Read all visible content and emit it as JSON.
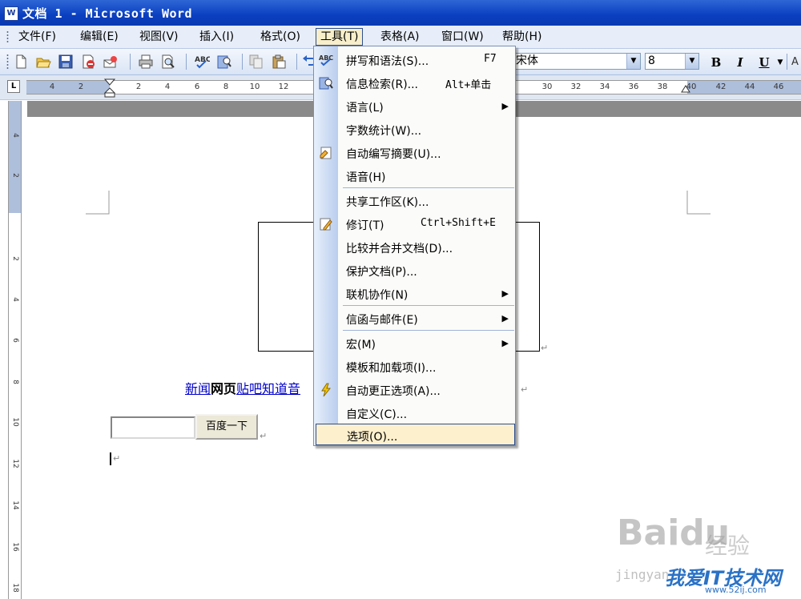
{
  "window": {
    "title": "文档 1 - Microsoft Word",
    "app_icon": "W"
  },
  "menubar": {
    "items": [
      {
        "label": "文件(F)"
      },
      {
        "label": "编辑(E)"
      },
      {
        "label": "视图(V)"
      },
      {
        "label": "插入(I)"
      },
      {
        "label": "格式(O)"
      },
      {
        "label": "工具(T)",
        "active": true
      },
      {
        "label": "表格(A)"
      },
      {
        "label": "窗口(W)"
      },
      {
        "label": "帮助(H)"
      }
    ]
  },
  "toolbar": {
    "font_name": "宋体",
    "font_size": "8",
    "bold_label": "B",
    "italic_label": "I",
    "underline_label": "U",
    "icons": [
      "new-icon",
      "open-icon",
      "save-icon",
      "permission-icon",
      "email-icon",
      "print-icon",
      "print-preview-icon",
      "spelling-icon",
      "research-icon",
      "copy-icon",
      "paste-icon",
      "undo-icon"
    ]
  },
  "ruler": {
    "tab_selector": "L",
    "numbers": [
      "4",
      "2",
      "2",
      "4",
      "6",
      "8",
      "10",
      "12",
      "30",
      "32",
      "34",
      "36",
      "38",
      "40",
      "42",
      "44",
      "46"
    ]
  },
  "vruler": {
    "numbers": [
      "4",
      "2",
      "2",
      "4",
      "6",
      "8",
      "10",
      "12",
      "14",
      "16",
      "18"
    ]
  },
  "tools_menu": {
    "items": [
      {
        "label": "拼写和语法(S)...",
        "shortcut": "F7",
        "icon": "spelling-icon"
      },
      {
        "label": "信息检索(R)...",
        "shortcut": "Alt+单击",
        "icon": "research-icon"
      },
      {
        "label": "语言(L)",
        "submenu": true
      },
      {
        "label": "字数统计(W)..."
      },
      {
        "label": "自动编写摘要(U)...",
        "icon": "autosummarize-icon"
      },
      {
        "label": "语音(H)"
      },
      {
        "label": "共享工作区(K)..."
      },
      {
        "label": "修订(T)",
        "shortcut": "Ctrl+Shift+E",
        "icon": "track-changes-icon"
      },
      {
        "label": "比较并合并文档(D)..."
      },
      {
        "label": "保护文档(P)..."
      },
      {
        "label": "联机协作(N)",
        "submenu": true
      },
      {
        "label": "信函与邮件(E)",
        "submenu": true
      },
      {
        "label": "宏(M)",
        "submenu": true
      },
      {
        "label": "模板和加载项(I)..."
      },
      {
        "label": "自动更正选项(A)...",
        "icon": "autocorrect-icon"
      },
      {
        "label": "自定义(C)..."
      },
      {
        "label": "选项(O)...",
        "highlighted": true
      }
    ]
  },
  "document": {
    "links": [
      {
        "text": "新闻",
        "style": "link"
      },
      {
        "text": "网页",
        "style": "bold"
      },
      {
        "text": "贴吧知道音",
        "style": "link"
      }
    ],
    "search_button": "百度一下"
  },
  "watermark": {
    "baidu": "Baidu",
    "jingyan": "经验",
    "url_partial": "jingyan",
    "site_cn": "我爱IT技术网",
    "site_url": "www.52ij.com"
  },
  "colors": {
    "titlebar": "#0a3fc0",
    "menu_highlight": "#fdf0cd",
    "link": "#0000cc"
  }
}
